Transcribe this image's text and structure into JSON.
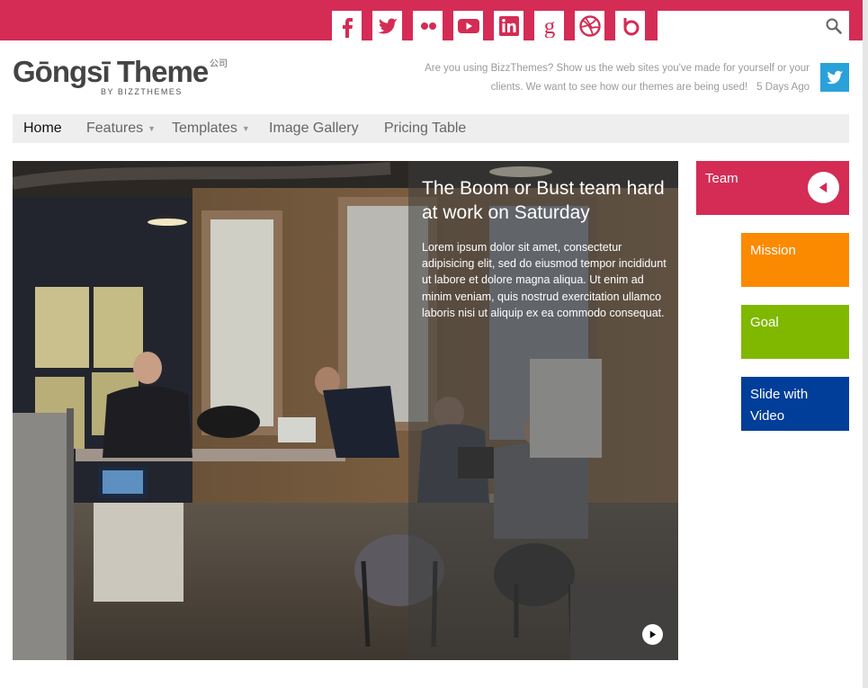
{
  "colors": {
    "brand": "#d42c55",
    "mission": "#fb8a00",
    "goal": "#80b800",
    "video": "#003e99",
    "twitter": "#2aa1d8"
  },
  "social_icons": [
    "facebook-icon",
    "twitter-icon",
    "flickr-icon",
    "youtube-icon",
    "linkedin-icon",
    "google-icon",
    "dribbble-icon",
    "behance-icon"
  ],
  "logo": {
    "title": "Gōngsī Theme",
    "chinese": "公司",
    "subtitle": "BY BIZZTHEMES"
  },
  "tweet": {
    "text": "Are you using BizzThemes? Show us the web sites you've made for yourself or your clients. We want to see how our themes are being used!",
    "time": "5 Days Ago"
  },
  "nav": {
    "home": "Home",
    "features": "Features",
    "templates": "Templates",
    "gallery": "Image Gallery",
    "pricing": "Pricing Table"
  },
  "slide": {
    "title": "The Boom or Bust team hard at work on Saturday",
    "text": "Lorem ipsum dolor sit amet, consectetur adipisicing elit, sed do eiusmod tempor incididunt ut labore et dolore magna aliqua. Ut enim ad minim veniam, quis nostrud exercitation ullamco laboris nisi ut aliquip ex ea commodo consequat."
  },
  "tabs": {
    "team": "Team",
    "mission": "Mission",
    "goal": "Goal",
    "video": "Slide with Video"
  }
}
